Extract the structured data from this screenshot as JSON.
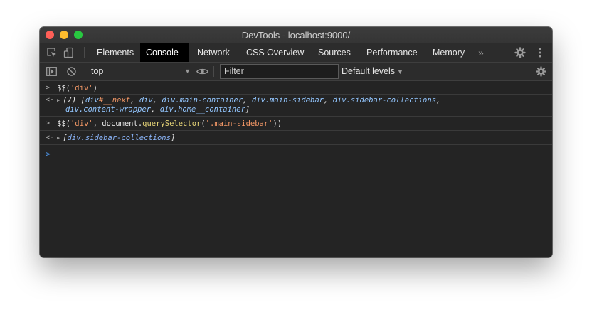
{
  "window": {
    "title": "DevTools - localhost:9000/"
  },
  "tabs": [
    {
      "label": "Elements"
    },
    {
      "label": "Console"
    },
    {
      "label": "Network"
    },
    {
      "label": "CSS Overview"
    },
    {
      "label": "Sources"
    },
    {
      "label": "Performance"
    },
    {
      "label": "Memory"
    }
  ],
  "tabbar": {
    "more_glyph": "»",
    "active_tab": "Console"
  },
  "toolbar": {
    "context": "top",
    "filter_placeholder": "Filter",
    "levels": "Default levels"
  },
  "console": {
    "entries": [
      {
        "input_cmd": "$$",
        "input_arg": "'div'"
      },
      {
        "count": "(7)",
        "items": [
          {
            "tag": "div",
            "suffix": "#__next"
          },
          {
            "tag": "div",
            "suffix": ""
          },
          {
            "tag": "div",
            "suffix": ".main-container"
          },
          {
            "tag": "div",
            "suffix": ".main-sidebar"
          },
          {
            "tag": "div",
            "suffix": ".sidebar-collections"
          },
          {
            "tag": "div",
            "suffix": ".content-wrapper"
          },
          {
            "tag": "div",
            "suffix": ".home__container"
          }
        ]
      },
      {
        "input_cmd": "$$",
        "input_arg": "'div'",
        "input_obj": "document",
        "input_method": "querySelector",
        "input_sel": "'.main-sidebar'"
      },
      {
        "result": "div.sidebar-collections"
      }
    ]
  },
  "colors": {
    "accent": "#4f9cf5",
    "string": "#f29766",
    "method": "#e5d377",
    "result_blue": "#8ab4f8"
  },
  "icons": [
    "inspect-element-icon",
    "device-toolbar-icon",
    "more-tabs-icon",
    "settings-gear-icon",
    "kebab-menu-icon",
    "sidebar-toggle-icon",
    "clear-console-icon",
    "eye-icon",
    "console-settings-gear-icon",
    "input-caret-icon",
    "output-arrow-icon",
    "expand-triangle-icon"
  ]
}
